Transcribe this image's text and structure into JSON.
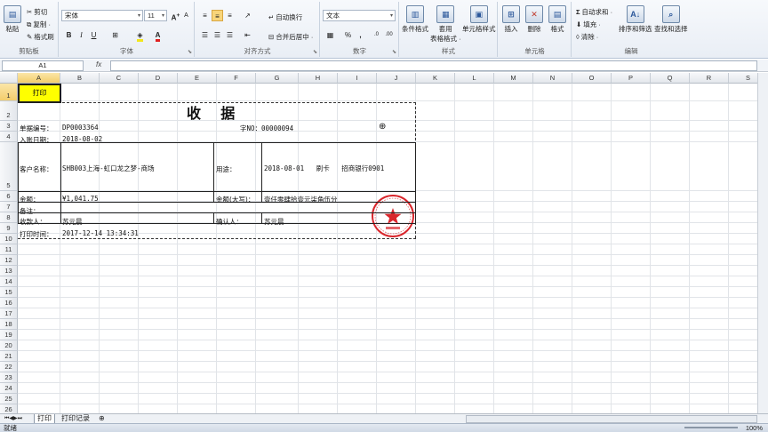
{
  "ribbon": {
    "clipboard": {
      "paste": "粘贴",
      "cut": "剪切",
      "copy": "复制 ·",
      "format_painter": "格式刷",
      "label": "剪贴板"
    },
    "font": {
      "name": "宋体",
      "size": "11",
      "bold": "B",
      "italic": "I",
      "underline": "U",
      "grow": "A",
      "shrink": "A",
      "fill_letter": "A",
      "label": "字体"
    },
    "alignment": {
      "wrap": "自动换行",
      "merge": "合并后居中 ·",
      "label": "对齐方式"
    },
    "number": {
      "format": "文本",
      "percent": "%",
      "comma": ",",
      "label": "数字"
    },
    "styles": {
      "conditional": "条件格式",
      "table_1": "套用",
      "table_2": "表格格式 ·",
      "cell_styles": "单元格样式",
      "label": "样式"
    },
    "cells": {
      "insert": "插入",
      "delete": "删除",
      "format": "格式",
      "label": "单元格"
    },
    "editing": {
      "autosum": "自动求和 ·",
      "fill": "填充 ·",
      "clear": "清除 ·",
      "sort": "排序和筛选",
      "find": "查找和选择",
      "label": "编辑"
    }
  },
  "formula_bar": {
    "name_box": "A1",
    "fx": "fx",
    "content": ""
  },
  "columns": [
    "A",
    "B",
    "C",
    "D",
    "E",
    "F",
    "G",
    "H",
    "I",
    "J",
    "K",
    "L",
    "M",
    "N",
    "O",
    "P",
    "Q",
    "R",
    "S"
  ],
  "rows": [
    "1",
    "2",
    "3",
    "4",
    "5",
    "6",
    "7",
    "8",
    "9",
    "10",
    "11",
    "12",
    "13",
    "14",
    "15",
    "16",
    "17",
    "18",
    "19",
    "20",
    "21",
    "22",
    "23",
    "24",
    "25",
    "26",
    "27",
    "28"
  ],
  "sheet": {
    "print_button": "打印",
    "title": "收    据",
    "bill_no_label": "单据编号：",
    "bill_no": "DP0003364",
    "zi_no": "字NO：00000094",
    "entry_date_label": "入账日期：",
    "entry_date": "2018-08-02",
    "customer_label": "客户名称：",
    "customer": "SHB003上海-虹口龙之梦-商场",
    "purpose_label": "用途：",
    "purpose": "2018-08-01   刷卡   招商银行0901",
    "amount_label": "金额：",
    "amount": "¥1,041.75",
    "amount_upper_label": "金额(大写)：",
    "amount_upper": "壹仟零肆拾壹元柒角伍分",
    "remark_label": "备注：",
    "payee_label": "收款人：",
    "payee": "苏元晨",
    "confirmer_label": "确认人：",
    "confirmer": "苏元晨",
    "print_time_label": "打印时间：",
    "print_time": "2017-12-14 13:34:31",
    "stamp_color": "#d9262c"
  },
  "tabs": {
    "sheet1": "打印",
    "sheet2": "打印记录"
  },
  "status": {
    "ready": "就绪",
    "zoom": "100%"
  }
}
